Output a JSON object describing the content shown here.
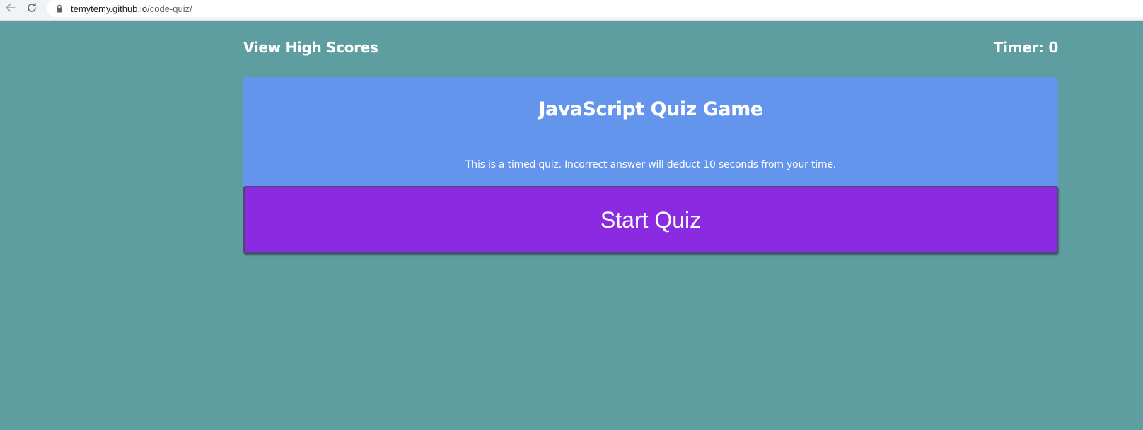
{
  "browser": {
    "url_host": "temytemy.github.io",
    "url_path": "/code-quiz/",
    "icons": {
      "back": "arrow-left-icon",
      "reload": "reload-icon",
      "lock": "lock-icon"
    }
  },
  "header": {
    "high_scores_label": "View High Scores",
    "timer_label": "Timer: 0"
  },
  "quiz": {
    "title": "JavaScript Quiz Game",
    "description": "This is a timed quiz. Incorrect answer will deduct 10 seconds from your time.",
    "start_label": "Start Quiz"
  },
  "colors": {
    "page_background": "#5f9ea0",
    "card_background": "#6495ed",
    "start_button": "#8a2be2",
    "text": "#ffffff"
  }
}
